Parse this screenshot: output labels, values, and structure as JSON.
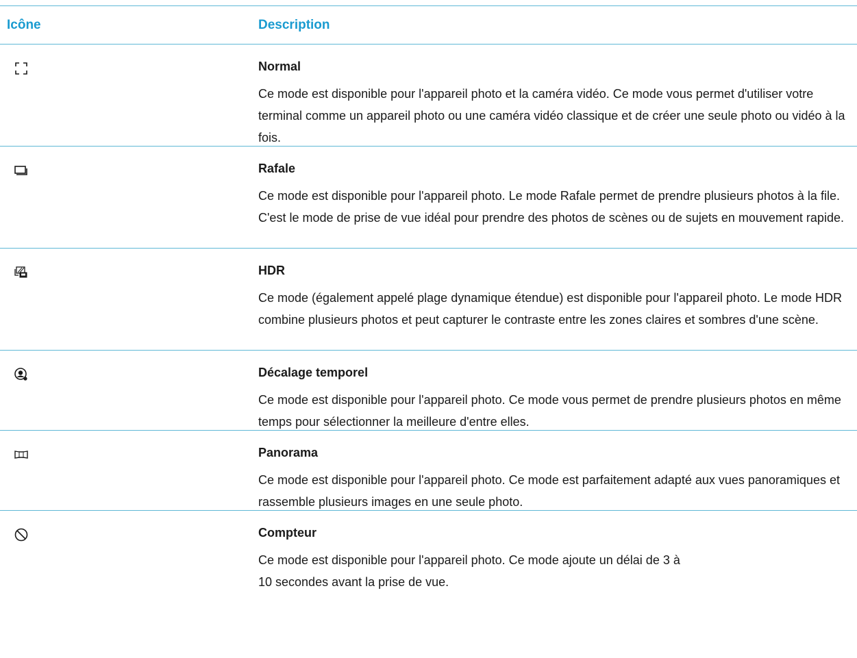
{
  "table": {
    "header": {
      "icon_col": "Icône",
      "desc_col": "Description"
    },
    "rows": [
      {
        "icon": "normal-frame-icon",
        "title": "Normal",
        "text": "Ce mode est disponible pour l'appareil photo et la caméra vidéo. Ce mode vous permet d'utiliser votre terminal comme un appareil photo ou une caméra vidéo classique et de créer une seule photo ou vidéo à la fois."
      },
      {
        "icon": "burst-icon",
        "title": "Rafale",
        "text": "Ce mode est disponible pour l'appareil photo. Le mode Rafale permet de prendre plusieurs photos à la file. C'est le mode de prise de vue idéal pour prendre des photos de scènes ou de sujets en mouvement rapide."
      },
      {
        "icon": "hdr-icon",
        "title": "HDR",
        "text": "Ce mode (également appelé plage dynamique étendue) est disponible pour l'appareil photo. Le mode HDR combine plusieurs photos et peut capturer le contraste entre les zones claires et sombres d'une scène."
      },
      {
        "icon": "time-shift-icon",
        "title": "Décalage temporel",
        "text": "Ce mode est disponible pour l'appareil photo. Ce mode vous permet de prendre plusieurs photos en même temps pour sélectionner la meilleure d'entre elles."
      },
      {
        "icon": "panorama-icon",
        "title": "Panorama",
        "text": "Ce mode est disponible pour l'appareil photo. Ce mode est parfaitement adapté aux vues panoramiques et rassemble plusieurs images en une seule photo."
      },
      {
        "icon": "timer-icon",
        "title": "Compteur",
        "text": "Ce mode est disponible pour l'appareil photo. Ce mode ajoute un délai de 3 à\n10 secondes avant la prise de vue."
      }
    ]
  },
  "colors": {
    "header_text": "#1a9bd0",
    "rule": "#5fb8d6",
    "body_text": "#1a1a1a"
  }
}
